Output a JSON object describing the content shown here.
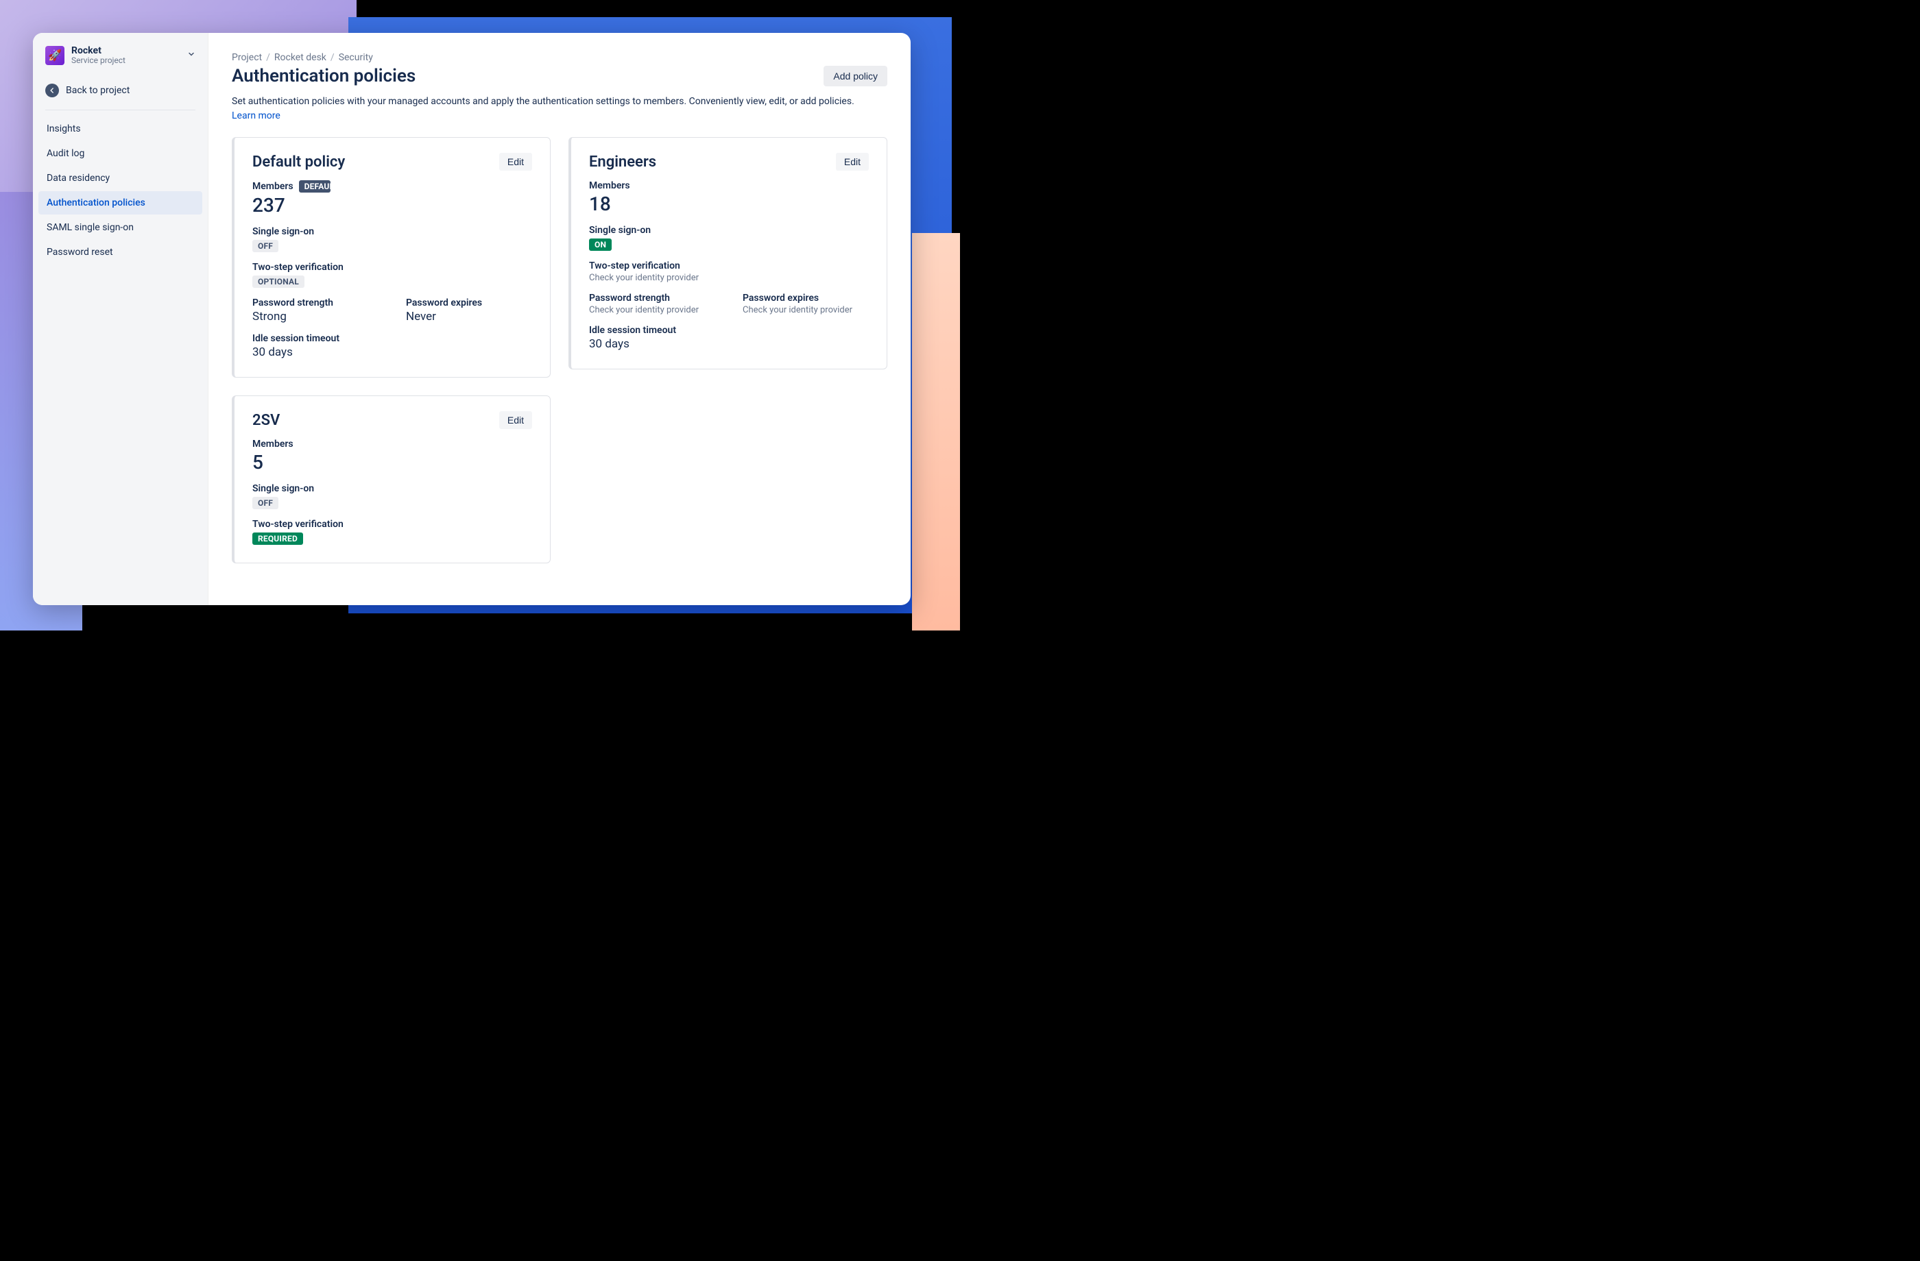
{
  "sidebar": {
    "project_name": "Rocket",
    "project_sub": "Service project",
    "back_label": "Back to project",
    "items": [
      {
        "label": "Insights"
      },
      {
        "label": "Audit log"
      },
      {
        "label": "Data residency"
      },
      {
        "label": "Authentication policies"
      },
      {
        "label": "SAML single sign-on"
      },
      {
        "label": "Password reset"
      }
    ],
    "active_index": 3
  },
  "breadcrumb": [
    "Project",
    "Rocket desk",
    "Security"
  ],
  "header": {
    "title": "Authentication policies",
    "add_button": "Add policy",
    "description": "Set authentication policies with your managed accounts and apply the authentication settings to members. Conveniently view, edit, or add policies. ",
    "learn_more": "Learn more"
  },
  "labels": {
    "members": "Members",
    "sso": "Single sign-on",
    "two_step": "Two-step verification",
    "pw_strength": "Password strength",
    "pw_expires": "Password expires",
    "idle": "Idle session timeout",
    "edit": "Edit",
    "check_idp": "Check your identity provider"
  },
  "badges": {
    "default": "DEFAULT",
    "off": "OFF",
    "on": "ON",
    "optional": "OPTIONAL",
    "required": "REQUIRED"
  },
  "policies": [
    {
      "name": "Default policy",
      "is_default": true,
      "members": "237",
      "sso_on": false,
      "two_step": "optional",
      "pw_strength": "Strong",
      "pw_expires": "Never",
      "idle": "30 days"
    },
    {
      "name": "Engineers",
      "is_default": false,
      "members": "18",
      "sso_on": true,
      "two_step": "idp",
      "pw_strength": "idp",
      "pw_expires": "idp",
      "idle": "30 days"
    },
    {
      "name": "2SV",
      "is_default": false,
      "members": "5",
      "sso_on": false,
      "two_step": "required",
      "pw_strength": null,
      "pw_expires": null,
      "idle": null
    }
  ]
}
